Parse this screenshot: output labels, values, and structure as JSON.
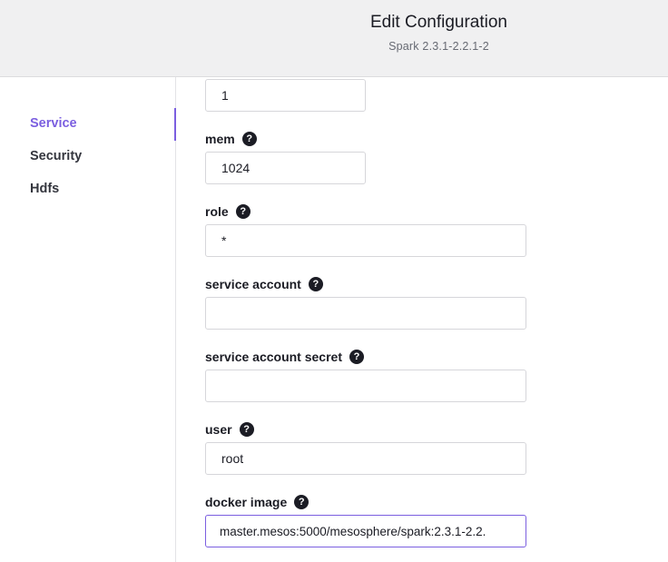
{
  "header": {
    "title": "Edit Configuration",
    "subtitle": "Spark 2.3.1-2.2.1-2"
  },
  "sidebar": {
    "items": [
      {
        "label": "Service",
        "active": true
      },
      {
        "label": "Security",
        "active": false
      },
      {
        "label": "Hdfs",
        "active": false
      }
    ]
  },
  "fields": {
    "cpus": {
      "value": "1"
    },
    "mem": {
      "label": "mem",
      "value": "1024"
    },
    "role": {
      "label": "role",
      "value": "*"
    },
    "service_account": {
      "label": "service account",
      "value": ""
    },
    "service_account_secret": {
      "label": "service account secret",
      "value": ""
    },
    "user": {
      "label": "user",
      "value": "root"
    },
    "docker_image": {
      "label": "docker image",
      "value": "master.mesos:5000/mesosphere/spark:2.3.1-2.2."
    }
  },
  "icons": {
    "help": "?"
  },
  "colors": {
    "accent": "#7b5fe0",
    "header_bg": "#f0f0f1",
    "text": "#1b1c24"
  }
}
